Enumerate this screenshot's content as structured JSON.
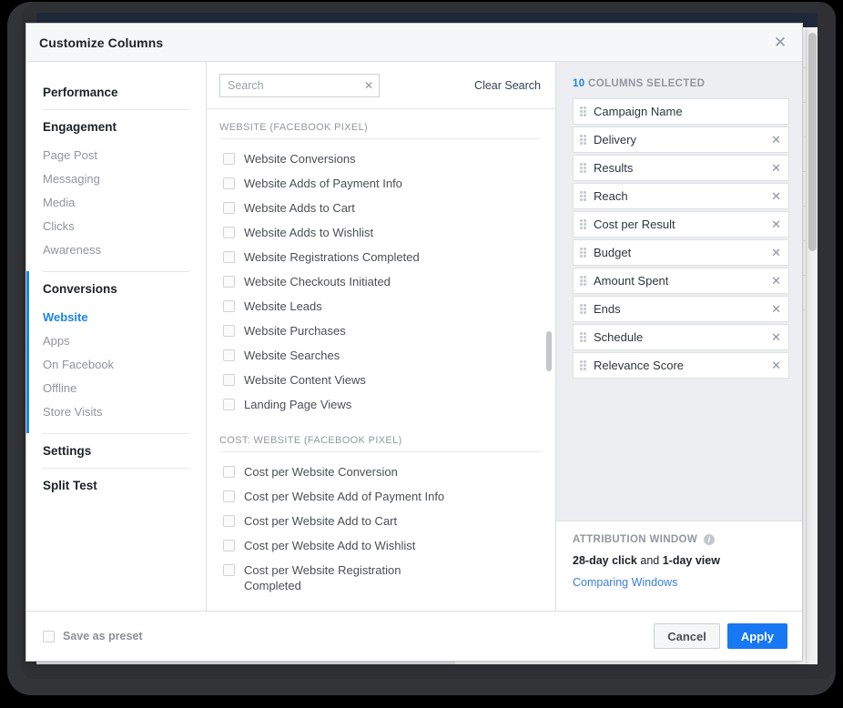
{
  "modal": {
    "title": "Customize Columns",
    "close_icon": "close-icon"
  },
  "sidebar": {
    "groups": [
      {
        "head": "Performance",
        "items": []
      },
      {
        "head": "Engagement",
        "items": [
          "Page Post",
          "Messaging",
          "Media",
          "Clicks",
          "Awareness"
        ]
      },
      {
        "head": "Conversions",
        "items": [
          "Website",
          "Apps",
          "On Facebook",
          "Offline",
          "Store Visits"
        ],
        "active": true,
        "selected_item": "Website"
      },
      {
        "head": "Settings",
        "items": []
      },
      {
        "head": "Split Test",
        "items": []
      }
    ]
  },
  "search": {
    "placeholder": "Search",
    "value": "",
    "clear_icon": "close-icon",
    "clear_search_label": "Clear Search"
  },
  "options": {
    "sections": [
      {
        "label": "WEBSITE (FACEBOOK PIXEL)",
        "items": [
          "Website Conversions",
          "Website Adds of Payment Info",
          "Website Adds to Cart",
          "Website Adds to Wishlist",
          "Website Registrations Completed",
          "Website Checkouts Initiated",
          "Website Leads",
          "Website Purchases",
          "Website Searches",
          "Website Content Views",
          "Landing Page Views"
        ]
      },
      {
        "label": "COST: WEBSITE (FACEBOOK PIXEL)",
        "items": [
          "Cost per Website Conversion",
          "Cost per Website Add of Payment Info",
          "Cost per Website Add to Cart",
          "Cost per Website Add to Wishlist",
          "Cost per Website Registration Completed"
        ]
      }
    ]
  },
  "selected": {
    "count": "10",
    "count_label": "COLUMNS SELECTED",
    "remove_icon": "close-icon",
    "drag_icon": "drag-handle-icon",
    "items": [
      {
        "label": "Campaign Name",
        "removable": false
      },
      {
        "label": "Delivery",
        "removable": true
      },
      {
        "label": "Results",
        "removable": true
      },
      {
        "label": "Reach",
        "removable": true
      },
      {
        "label": "Cost per Result",
        "removable": true
      },
      {
        "label": "Budget",
        "removable": true
      },
      {
        "label": "Amount Spent",
        "removable": true
      },
      {
        "label": "Ends",
        "removable": true
      },
      {
        "label": "Schedule",
        "removable": true
      },
      {
        "label": "Relevance Score",
        "removable": true
      }
    ]
  },
  "attribution": {
    "title": "ATTRIBUTION WINDOW",
    "info_icon": "info-icon",
    "click_window": "28-day click",
    "conjunction": " and ",
    "view_window": "1-day view",
    "link_label": "Comparing Windows"
  },
  "footer": {
    "save_preset_label": "Save as preset",
    "cancel_label": "Cancel",
    "apply_label": "Apply"
  },
  "colors": {
    "accent_blue": "#1b84e7",
    "apply_blue": "#1877f2",
    "panel_grey": "#eceef1",
    "text_dark": "#1d2129",
    "text_muted": "#90949c"
  }
}
